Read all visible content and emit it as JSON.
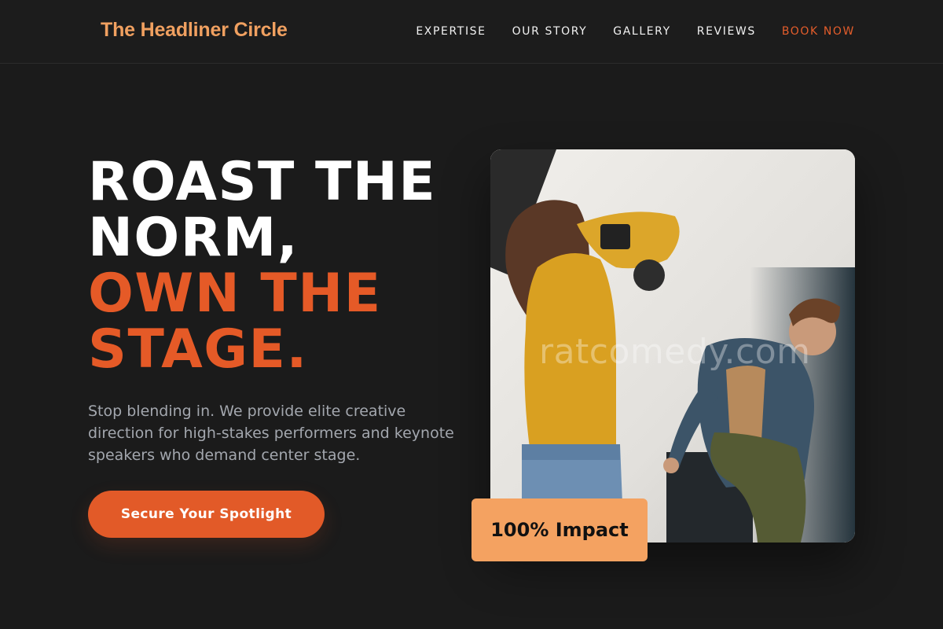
{
  "brand": {
    "name": "The Headliner Circle"
  },
  "nav": {
    "items": [
      {
        "label": "EXPERTISE"
      },
      {
        "label": "OUR STORY"
      },
      {
        "label": "GALLERY"
      },
      {
        "label": "REVIEWS"
      },
      {
        "label": "BOOK NOW"
      }
    ]
  },
  "hero": {
    "headline": {
      "line1": "ROAST THE",
      "line2": "NORM,",
      "line3": "OWN THE",
      "line4": "STAGE."
    },
    "subtitle": "Stop blending in. We provide elite creative direction for high-stakes performers and keynote speakers who demand center stage.",
    "cta_label": "Secure Your Spotlight"
  },
  "media": {
    "watermark": "ratcomedy.com",
    "badge": "100% Impact"
  },
  "colors": {
    "background": "#1b1b1b",
    "accent": "#e55a27",
    "logo": "#f0a060",
    "badge": "#f4a261",
    "body_text": "#a3a7ae"
  }
}
